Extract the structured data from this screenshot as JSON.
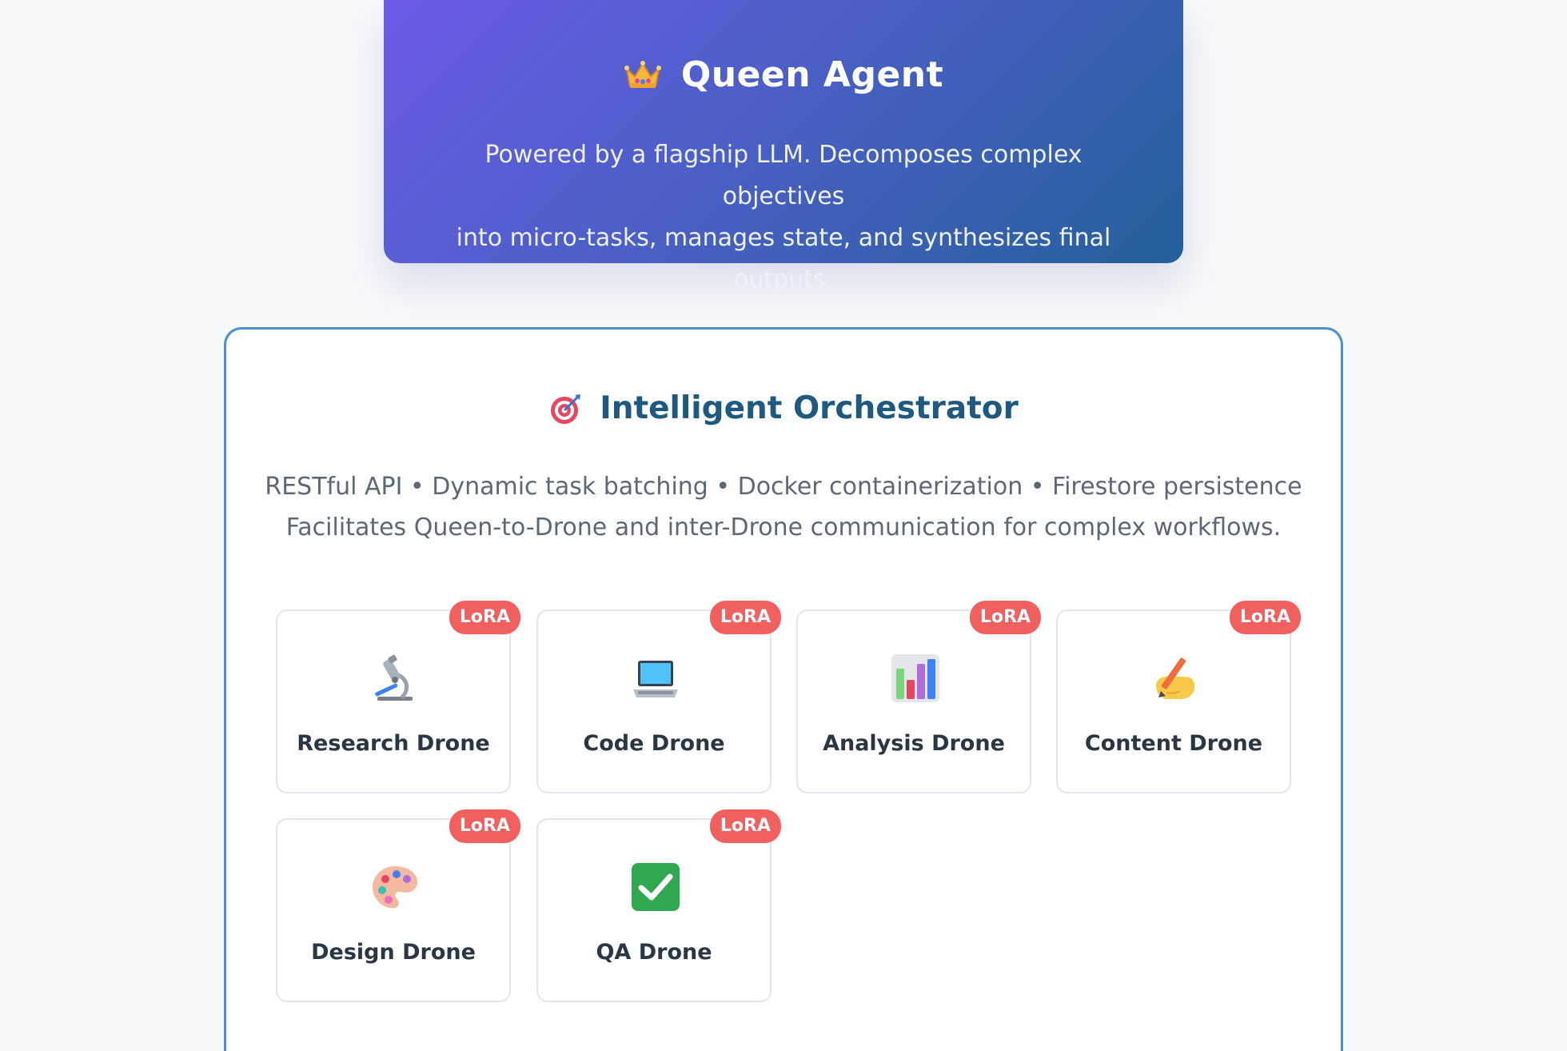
{
  "queen": {
    "icon": "crown-icon",
    "title": "Queen Agent",
    "description_line1": "Powered by a flagship LLM. Decomposes complex objectives",
    "description_line2": "into micro-tasks, manages state, and synthesizes final outputs."
  },
  "orchestrator": {
    "icon": "target-icon",
    "title": "Intelligent Orchestrator",
    "description_line1": "RESTful API • Dynamic task batching • Docker containerization • Firestore persistence",
    "description_line2": "Facilitates Queen-to-Drone and inter-Drone communication for complex workflows."
  },
  "drones": [
    {
      "label": "Research Drone",
      "badge": "LoRA",
      "icon": "microscope-icon"
    },
    {
      "label": "Code Drone",
      "badge": "LoRA",
      "icon": "laptop-icon"
    },
    {
      "label": "Analysis Drone",
      "badge": "LoRA",
      "icon": "bar-chart-icon"
    },
    {
      "label": "Content Drone",
      "badge": "LoRA",
      "icon": "writing-hand-icon"
    },
    {
      "label": "Design Drone",
      "badge": "LoRA",
      "icon": "palette-icon"
    },
    {
      "label": "QA Drone",
      "badge": "LoRA",
      "icon": "check-box-icon"
    }
  ],
  "colors": {
    "queen_gradient_start": "#6c5ce7",
    "queen_gradient_end": "#25609a",
    "orchestrator_border": "#4a8fd9",
    "orchestrator_title": "#1e5a80",
    "badge": "#f25f5f"
  }
}
